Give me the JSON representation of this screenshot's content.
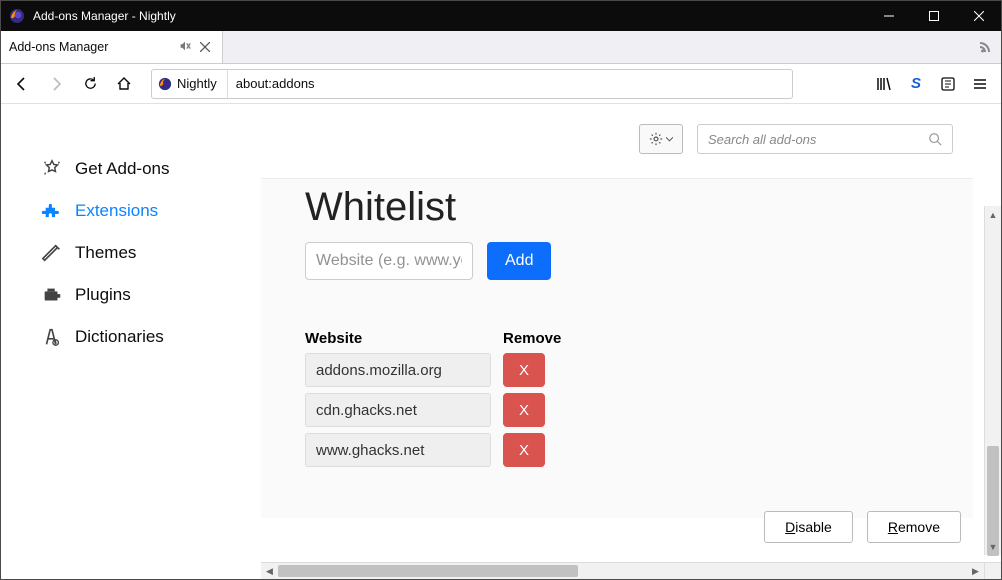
{
  "window": {
    "title": "Add-ons Manager - Nightly"
  },
  "tab": {
    "label": "Add-ons Manager"
  },
  "addressbar": {
    "identity": "Nightly",
    "url": "about:addons"
  },
  "sidebar": {
    "items": [
      {
        "label": "Get Add-ons"
      },
      {
        "label": "Extensions"
      },
      {
        "label": "Themes"
      },
      {
        "label": "Plugins"
      },
      {
        "label": "Dictionaries"
      }
    ]
  },
  "search": {
    "placeholder": "Search all add-ons"
  },
  "panel": {
    "heading": "Whitelist",
    "input_placeholder": "Website (e.g. www.yourwebsite.com)",
    "add_label": "Add",
    "table": {
      "col_website": "Website",
      "col_remove": "Remove",
      "rows": [
        {
          "site": "addons.mozilla.org",
          "remove": "X"
        },
        {
          "site": "cdn.ghacks.net",
          "remove": "X"
        },
        {
          "site": "www.ghacks.net",
          "remove": "X"
        }
      ]
    }
  },
  "buttons": {
    "disable": "Disable",
    "remove": "Remove"
  }
}
